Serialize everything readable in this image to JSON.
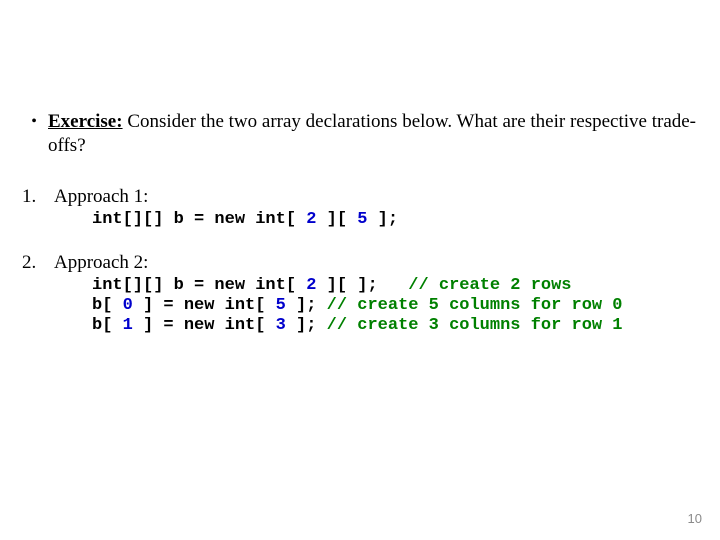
{
  "exercise": {
    "label": "Exercise:",
    "prompt": "Consider the two array declarations below. What are their respective trade-offs?"
  },
  "approach1": {
    "num": "1.",
    "title": "Approach 1:",
    "code": {
      "pre": "int[][] b = new int[ ",
      "n1": "2",
      "mid": " ][ ",
      "n2": "5",
      "post": " ];"
    }
  },
  "approach2": {
    "num": "2.",
    "title": "Approach 2:",
    "line1": {
      "pre": "int[][] b = new int[ ",
      "n": "2",
      "post": " ][ ];   ",
      "comment": "// create 2 rows"
    },
    "line2": {
      "pre": "b[ ",
      "idx": "0",
      "mid": " ] = new int[ ",
      "n": "5",
      "post": " ]; ",
      "comment": "// create 5 columns for row 0"
    },
    "line3": {
      "pre": "b[ ",
      "idx": "1",
      "mid": " ] = new int[ ",
      "n": "3",
      "post": " ]; ",
      "comment": "// create 3 columns for row 1"
    }
  },
  "page_number": "10"
}
